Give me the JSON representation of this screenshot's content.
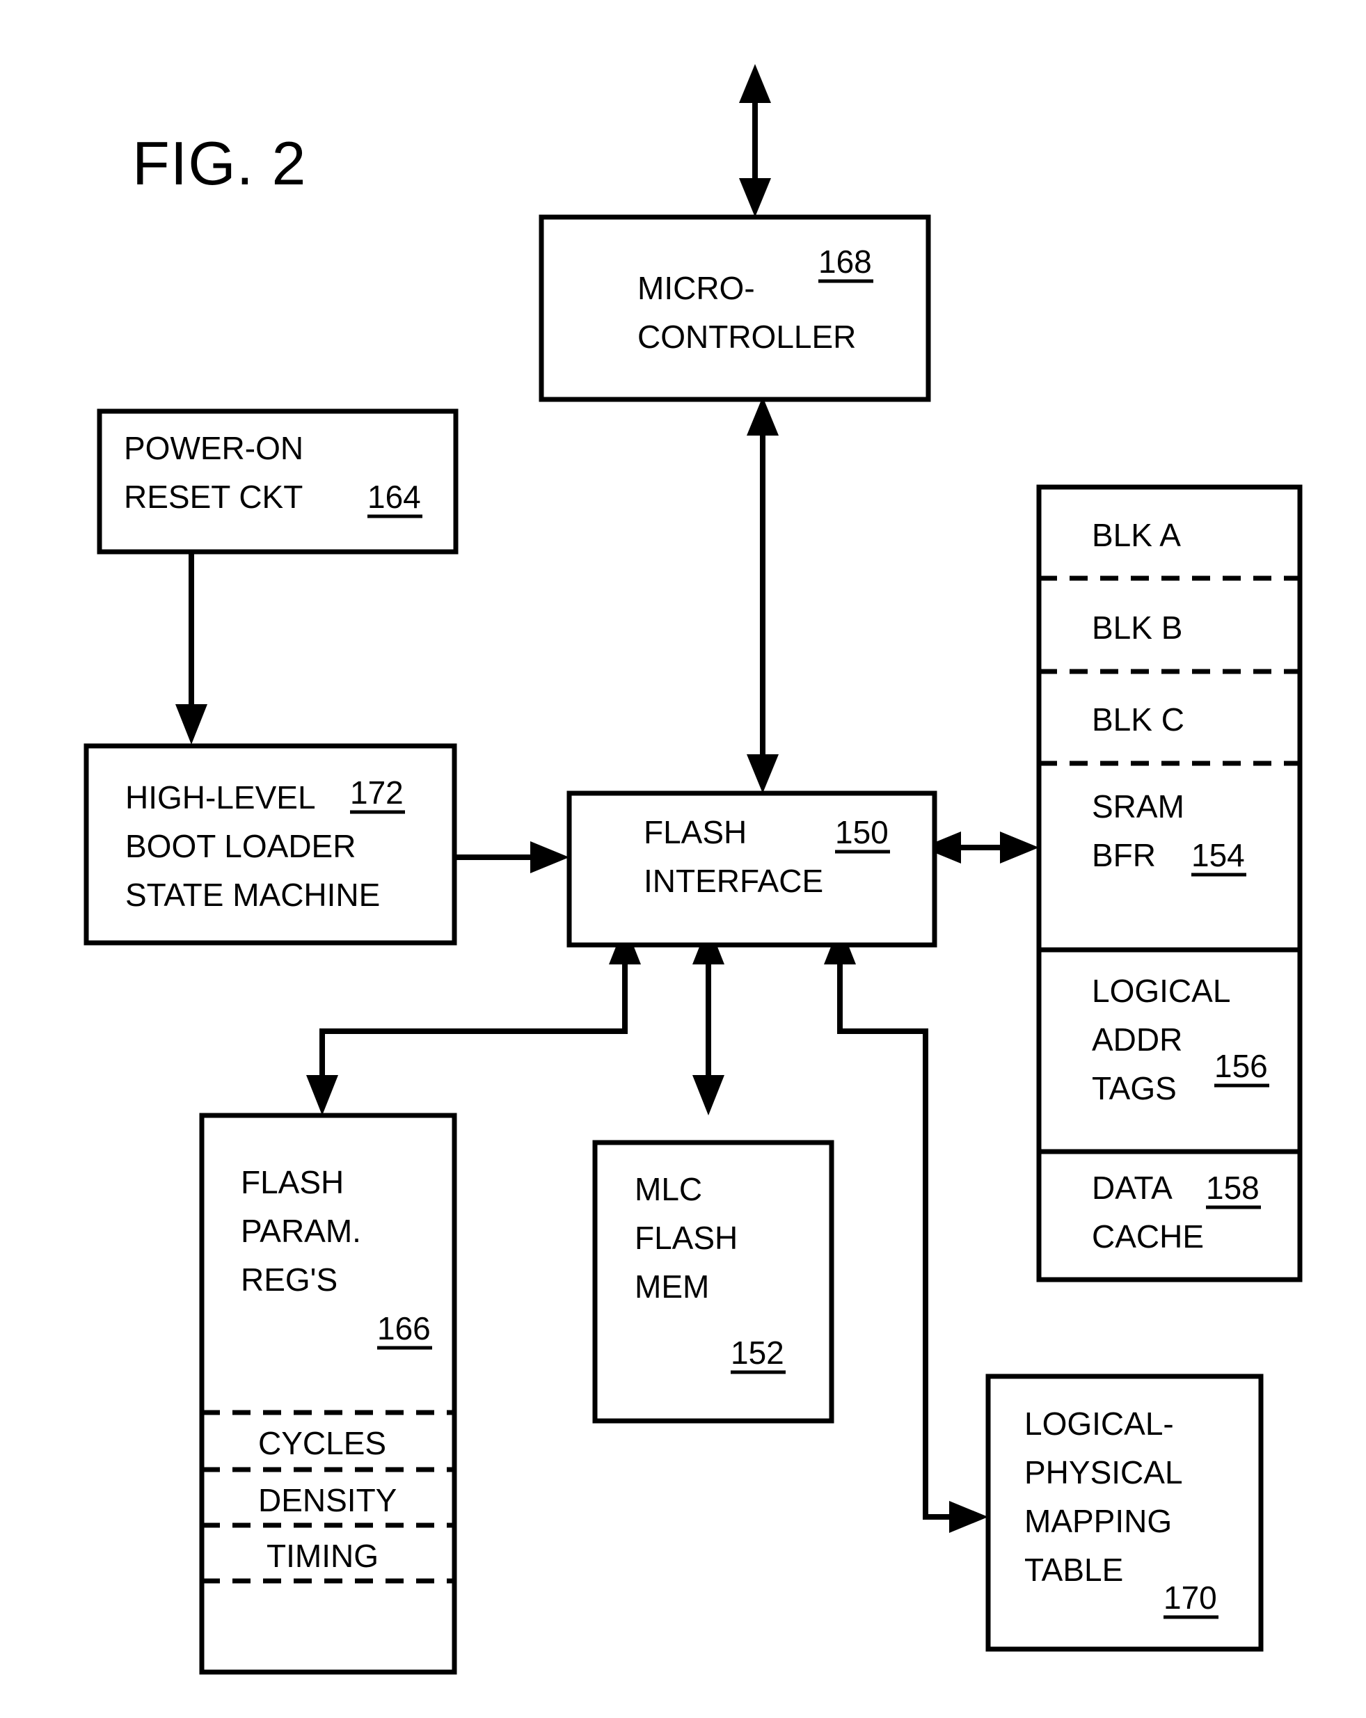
{
  "figure": {
    "title": "FIG. 2",
    "type": "patent-block-diagram"
  },
  "blocks": {
    "microcontroller": {
      "line1": "MICRO-",
      "line2": "CONTROLLER",
      "ref": "168"
    },
    "power_on_reset": {
      "line1": "POWER-ON",
      "line2": "RESET CKT",
      "ref": "164"
    },
    "boot_loader": {
      "line1": "HIGH-LEVEL",
      "line2": "BOOT LOADER",
      "line3": "STATE MACHINE",
      "ref": "172"
    },
    "flash_interface": {
      "line1": "FLASH",
      "line2": "INTERFACE",
      "ref": "150"
    },
    "memory_stack": {
      "blk_a": "BLK A",
      "blk_b": "BLK B",
      "blk_c": "BLK C",
      "sram_line1": "SRAM",
      "sram_line2": "BFR",
      "sram_ref": "154",
      "tags_line1": "LOGICAL",
      "tags_line2": "ADDR",
      "tags_line3": "TAGS",
      "tags_ref": "156",
      "cache_line1": "DATA",
      "cache_line2": "CACHE",
      "cache_ref": "158"
    },
    "flash_param_regs": {
      "line1": "FLASH",
      "line2": "PARAM.",
      "line3": "REG'S",
      "ref": "166",
      "field1": "CYCLES",
      "field2": "DENSITY",
      "field3": "TIMING"
    },
    "mlc_flash_mem": {
      "line1": "MLC",
      "line2": "FLASH",
      "line3": "MEM",
      "ref": "152"
    },
    "mapping_table": {
      "line1": "LOGICAL-",
      "line2": "PHYSICAL",
      "line3": "MAPPING",
      "line4": "TABLE",
      "ref": "170"
    }
  },
  "colors": {
    "ink": "#000000",
    "paper": "#ffffff"
  }
}
